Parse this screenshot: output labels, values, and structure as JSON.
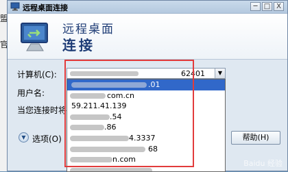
{
  "background_strip": {
    "chars": [
      "盟",
      "官",
      "",
      "2",
      "",
      "",
      "",
      ""
    ]
  },
  "window": {
    "title": "远程桌面连接",
    "controls": {
      "minimize": "─",
      "maximize": "□",
      "close": "X"
    }
  },
  "banner": {
    "line1": "远程桌面",
    "line2": "连接"
  },
  "form": {
    "computer_label": "计算机(C):",
    "computer_value_suffix": "62401",
    "username_label": "用户名:",
    "prompt_label": "当您连接时将"
  },
  "dropdown": {
    "items": [
      {
        "text": ".01",
        "selected": true
      },
      {
        "text": "com.cn",
        "selected": false
      },
      {
        "text": "59.211.41.139",
        "selected": false
      },
      {
        "text": ".54",
        "selected": false
      },
      {
        "text": ".86",
        "selected": false
      },
      {
        "text": "4.3337",
        "selected": false
      },
      {
        "text": "68",
        "selected": false
      },
      {
        "text": "n.com",
        "selected": false
      },
      {
        "text": "",
        "selected": false
      }
    ]
  },
  "buttons": {
    "options_label": "选项(O)",
    "help_label": "帮助(H)"
  },
  "watermark": "Baidu 经验"
}
